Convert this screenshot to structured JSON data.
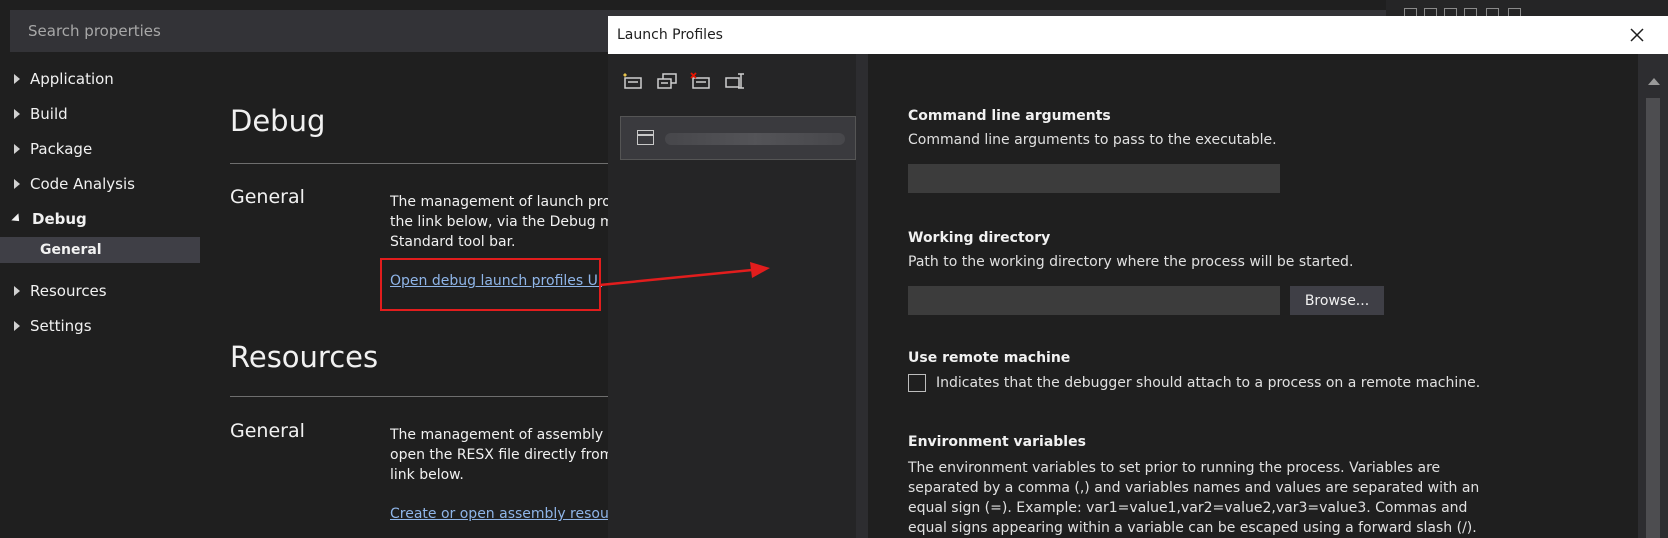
{
  "search": {
    "placeholder": "Search properties"
  },
  "sidebar": {
    "items": [
      {
        "label": "Application"
      },
      {
        "label": "Build"
      },
      {
        "label": "Package"
      },
      {
        "label": "Code Analysis"
      },
      {
        "label": "Debug"
      },
      {
        "label": "General"
      },
      {
        "label": "Resources"
      },
      {
        "label": "Settings"
      }
    ]
  },
  "main": {
    "debug_title": "Debug",
    "debug_general": "General",
    "debug_para": [
      "The management of launch profi",
      "the link below, via the Debug me",
      "Standard tool bar."
    ],
    "debug_link": "Open debug launch profiles UI",
    "resources_title": "Resources",
    "resources_general": "General",
    "resources_para": [
      "The management of assembly res",
      "open the RESX file directly from S",
      "link below."
    ],
    "resources_link": "Create or open assembly resourc"
  },
  "dialog": {
    "title": "Launch Profiles",
    "command_line": {
      "label": "Command line arguments",
      "desc": "Command line arguments to pass to the executable.",
      "value": ""
    },
    "working_dir": {
      "label": "Working directory",
      "desc": "Path to the working directory where the process will be started.",
      "value": "",
      "browse": "Browse..."
    },
    "remote": {
      "label": "Use remote machine",
      "desc": "Indicates that the debugger should attach to a process on a remote machine.",
      "checked": false
    },
    "env": {
      "label": "Environment variables",
      "desc": "The environment variables to set prior to running the process. Variables are separated by a comma (,) and variables names and values are separated with an equal sign (=). Example: var1=value1,var2=value2,var3=value3. Commas and equal signs appearing within a variable can be escaped using a forward slash (/)."
    }
  },
  "colors": {
    "background": "#1f1f1f",
    "link": "#8fb5e8",
    "annotation_red": "#e21d1d",
    "dialog_titlebar": "#ffffff"
  }
}
